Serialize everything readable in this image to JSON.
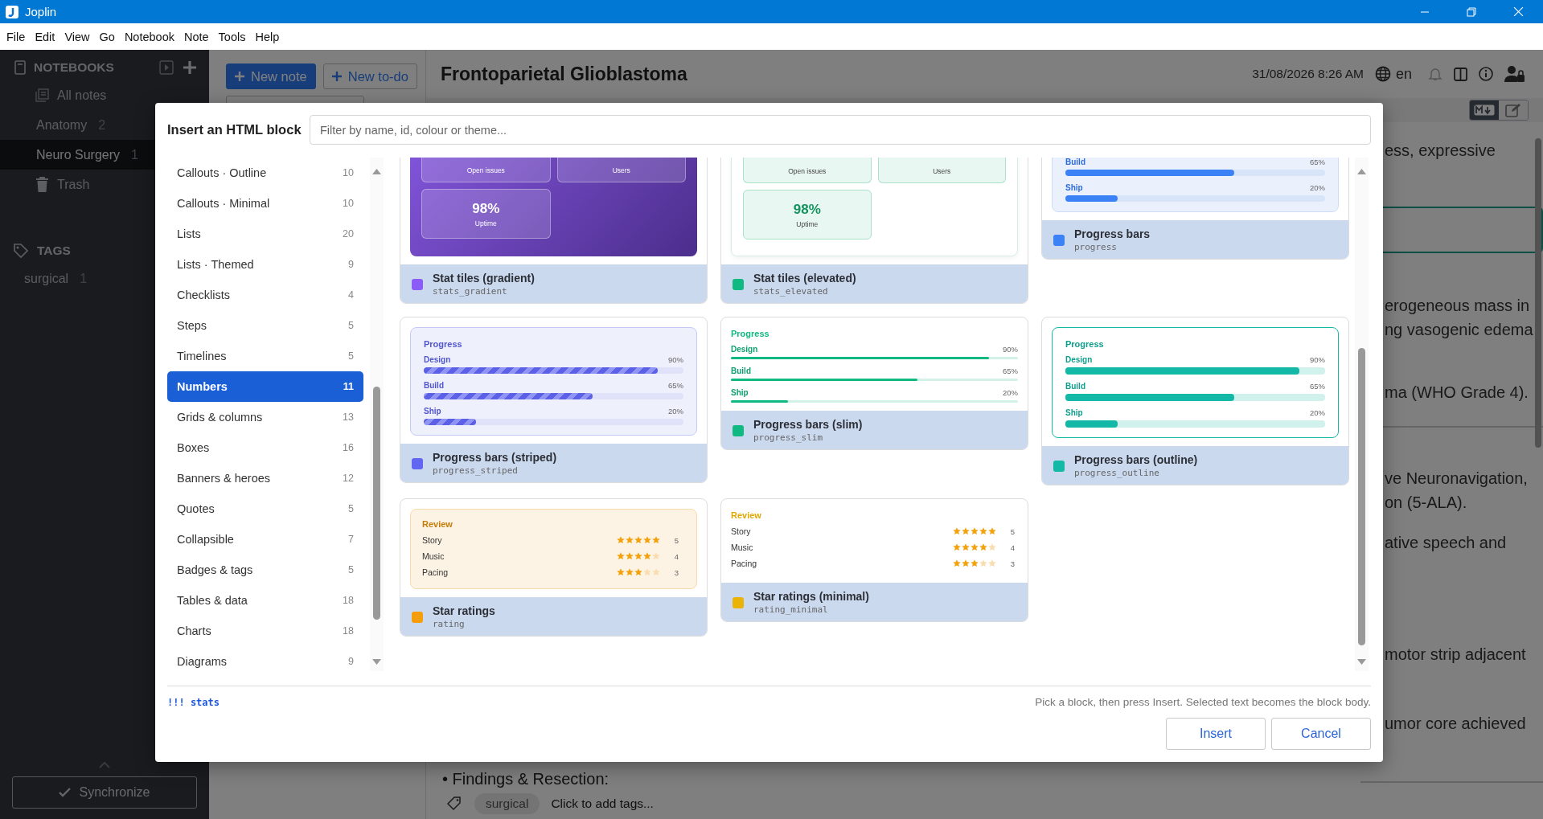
{
  "window": {
    "title": "Joplin"
  },
  "menu": [
    "File",
    "Edit",
    "View",
    "Go",
    "Notebook",
    "Note",
    "Tools",
    "Help"
  ],
  "sidebar": {
    "notebooks_heading": "NOTEBOOKS",
    "items": [
      {
        "kind": "all",
        "label": "All notes",
        "selected": false
      },
      {
        "kind": "notebook",
        "label": "Anatomy",
        "count": "2",
        "selected": false
      },
      {
        "kind": "notebook",
        "label": "Neuro Surgery",
        "count": "1",
        "selected": true
      },
      {
        "kind": "trash",
        "label": "Trash",
        "selected": false
      }
    ],
    "tags_heading": "TAGS",
    "tags": [
      {
        "label": "surgical",
        "count": "1"
      }
    ],
    "sync_button": "Synchronize"
  },
  "note_list": {
    "new_note": "New note",
    "new_todo": "New to-do"
  },
  "editor": {
    "title": "Frontoparietal Glioblastoma",
    "datetime": "31/08/2026 8:26 AM",
    "language": "en",
    "fragments": [
      {
        "kind": "text",
        "lines": [
          "ess, expressive"
        ]
      },
      {
        "kind": "callout"
      },
      {
        "kind": "text",
        "lines": [
          "erogeneous mass in",
          "ng vasogenic edema"
        ]
      },
      {
        "kind": "text",
        "lines": [
          "ma (WHO Grade 4)."
        ]
      },
      {
        "kind": "rule"
      },
      {
        "kind": "text",
        "lines": [
          "ve Neuronavigation,",
          "on (5-ALA)."
        ]
      },
      {
        "kind": "text",
        "lines": [
          "ative speech and"
        ]
      },
      {
        "kind": "text",
        "lines": [
          "motor strip adjacent"
        ]
      },
      {
        "kind": "text",
        "lines": [
          "umor core achieved"
        ]
      },
      {
        "kind": "rule"
      }
    ],
    "bullet": "• Findings & Resection:",
    "tags": [
      "surgical"
    ],
    "add_tags": "Click to add tags..."
  },
  "dialog": {
    "title": "Insert an HTML block",
    "filter": {
      "placeholder": "Filter by name, id, colour or theme..."
    },
    "categories": [
      {
        "label": "Callouts · Outline",
        "count": "10",
        "selected": false
      },
      {
        "label": "Callouts · Minimal",
        "count": "10",
        "selected": false
      },
      {
        "label": "Lists",
        "count": "20",
        "selected": false
      },
      {
        "label": "Lists · Themed",
        "count": "9",
        "selected": false
      },
      {
        "label": "Checklists",
        "count": "4",
        "selected": false
      },
      {
        "label": "Steps",
        "count": "5",
        "selected": false
      },
      {
        "label": "Timelines",
        "count": "5",
        "selected": false
      },
      {
        "label": "Numbers",
        "count": "11",
        "selected": true
      },
      {
        "label": "Grids & columns",
        "count": "13",
        "selected": false
      },
      {
        "label": "Boxes",
        "count": "16",
        "selected": false
      },
      {
        "label": "Banners & heroes",
        "count": "12",
        "selected": false
      },
      {
        "label": "Quotes",
        "count": "5",
        "selected": false
      },
      {
        "label": "Collapsible",
        "count": "7",
        "selected": false
      },
      {
        "label": "Badges & tags",
        "count": "5",
        "selected": false
      },
      {
        "label": "Tables & data",
        "count": "18",
        "selected": false
      },
      {
        "label": "Charts",
        "count": "18",
        "selected": false
      },
      {
        "label": "Diagrams",
        "count": "9",
        "selected": false
      }
    ],
    "blocks": [
      {
        "name": "Stat tiles (gradient)",
        "id": "stats_gradient",
        "color": "#8b5cf6",
        "preview": {
          "kind": "gradient-stats",
          "tiles": [
            {
              "label": "Open issues"
            },
            {
              "label": "Users"
            },
            {
              "value": "98%",
              "label": "Uptime"
            }
          ]
        }
      },
      {
        "name": "Stat tiles (elevated)",
        "id": "stats_elevated",
        "color": "#10b981",
        "preview": {
          "kind": "elevated-stats",
          "tiles": [
            {
              "label": "Open issues"
            },
            {
              "label": "Users"
            },
            {
              "value": "98%",
              "label": "Uptime"
            }
          ]
        }
      },
      {
        "name": "Progress bars",
        "id": "progress",
        "color": "#3b82f6",
        "preview": {
          "kind": "plain-progress",
          "bars": [
            {
              "label": "Build",
              "reading": "65%",
              "level": 0.65
            },
            {
              "label": "Ship",
              "reading": "20%",
              "level": 0.2
            }
          ]
        }
      },
      {
        "name": "Progress bars (striped)",
        "id": "progress_striped",
        "color": "#6366f1",
        "preview": {
          "kind": "striped-progress",
          "title": "Progress",
          "bars": [
            {
              "label": "Design",
              "reading": "90%",
              "level": 0.9
            },
            {
              "label": "Build",
              "reading": "65%",
              "level": 0.65
            },
            {
              "label": "Ship",
              "reading": "20%",
              "level": 0.2
            }
          ]
        }
      },
      {
        "name": "Progress bars (slim)",
        "id": "progress_slim",
        "color": "#10b981",
        "preview": {
          "kind": "slim-progress",
          "title": "Progress",
          "bars": [
            {
              "label": "Design",
              "reading": "90%",
              "level": 0.9
            },
            {
              "label": "Build",
              "reading": "65%",
              "level": 0.65
            },
            {
              "label": "Ship",
              "reading": "20%",
              "level": 0.2
            }
          ]
        }
      },
      {
        "name": "Progress bars (outline)",
        "id": "progress_outline",
        "color": "#14b8a6",
        "preview": {
          "kind": "outline-progress",
          "title": "Progress",
          "bars": [
            {
              "label": "Design",
              "reading": "90%",
              "level": 0.9
            },
            {
              "label": "Build",
              "reading": "65%",
              "level": 0.65
            },
            {
              "label": "Ship",
              "reading": "20%",
              "level": 0.2
            }
          ]
        }
      },
      {
        "name": "Star ratings",
        "id": "rating",
        "color": "#f59e0b",
        "preview": {
          "kind": "warm-rating",
          "title": "Review",
          "rows": [
            {
              "label": "Story",
              "stars": 5,
              "reading": "5"
            },
            {
              "label": "Music",
              "stars": 4,
              "reading": "4"
            },
            {
              "label": "Pacing",
              "stars": 3,
              "reading": "3"
            }
          ]
        }
      },
      {
        "name": "Star ratings (minimal)",
        "id": "rating_minimal",
        "color": "#eab308",
        "preview": {
          "kind": "minimal-rating",
          "title": "Review",
          "rows": [
            {
              "label": "Story",
              "stars": 5,
              "reading": "5"
            },
            {
              "label": "Music",
              "stars": 4,
              "reading": "4"
            },
            {
              "label": "Pacing",
              "stars": 3,
              "reading": "3"
            }
          ]
        }
      }
    ],
    "selection": "!!! stats",
    "hint": "Pick a block, then press Insert. Selected text becomes the block body.",
    "buttons": [
      "Insert",
      "Cancel"
    ]
  }
}
